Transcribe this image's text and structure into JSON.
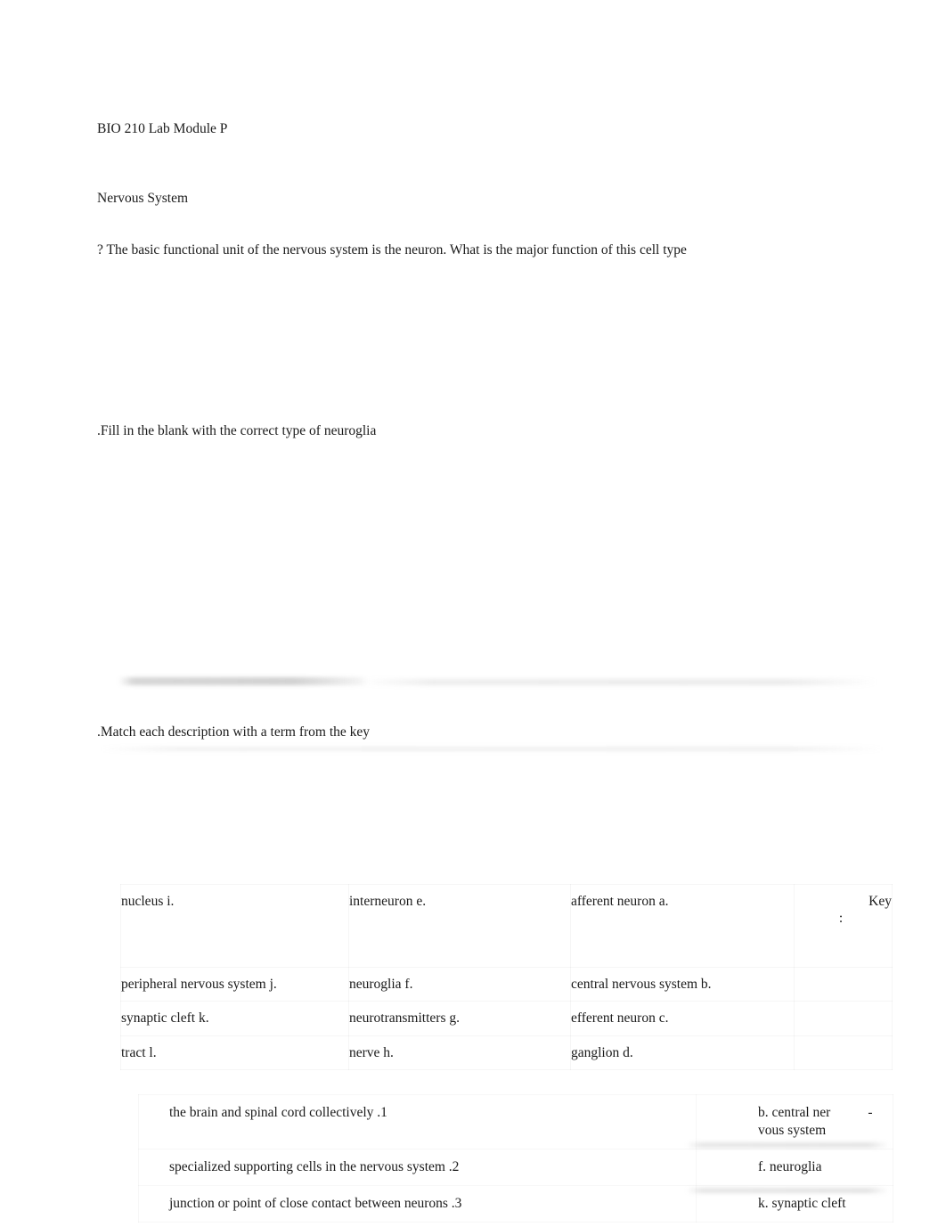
{
  "document": {
    "title": "BIO 210 Lab Module P",
    "section_title": "Nervous System",
    "questions": {
      "q1": "? The basic functional unit of the nervous system is the neuron. What is the major function of this cell type",
      "q2": ".Fill in the blank with the correct type of neuroglia",
      "q3": ".Match each description with a term from the key"
    }
  },
  "key": {
    "label": "Key",
    "colon": ":",
    "terms": [
      {
        "letter": "a.",
        "term": "afferent neuron",
        "display": "afferent neuron    a."
      },
      {
        "letter": "b.",
        "term": "central nervous system",
        "display": "central nervous system    b."
      },
      {
        "letter": "c.",
        "term": "efferent neuron",
        "display": "efferent neuron    c."
      },
      {
        "letter": "d.",
        "term": "ganglion",
        "display": "ganglion    d."
      },
      {
        "letter": "e.",
        "term": "interneuron",
        "display": "interneuron    e."
      },
      {
        "letter": "f.",
        "term": "neuroglia",
        "display": "neuroglia    f."
      },
      {
        "letter": "g.",
        "term": "neurotransmitters",
        "display": "neurotransmitters    g."
      },
      {
        "letter": "h.",
        "term": "nerve",
        "display": "nerve    h."
      },
      {
        "letter": "i.",
        "term": "nucleus",
        "display": "nucleus    i."
      },
      {
        "letter": "j.",
        "term": "peripheral nervous system",
        "display": "peripheral nervous system    j."
      },
      {
        "letter": "k.",
        "term": "synaptic cleft",
        "display": "synaptic cleft    k."
      },
      {
        "letter": "l.",
        "term": "tract",
        "display": "tract    l."
      }
    ]
  },
  "matching": {
    "items": [
      {
        "number": ".1",
        "description": "the brain and spinal cord collectively    .1",
        "answer_line1": "b. central ner",
        "answer_hyphen": "-",
        "answer_line2": "vous system"
      },
      {
        "number": ".2",
        "description": "specialized supporting cells in the nervous system    .2",
        "answer_line1": "f. neuroglia",
        "answer_hyphen": "",
        "answer_line2": ""
      },
      {
        "number": ".3",
        "description": "junction or point of close contact between neurons    .3",
        "answer_line1": "k. synaptic cleft",
        "answer_hyphen": "",
        "answer_line2": ""
      }
    ]
  }
}
